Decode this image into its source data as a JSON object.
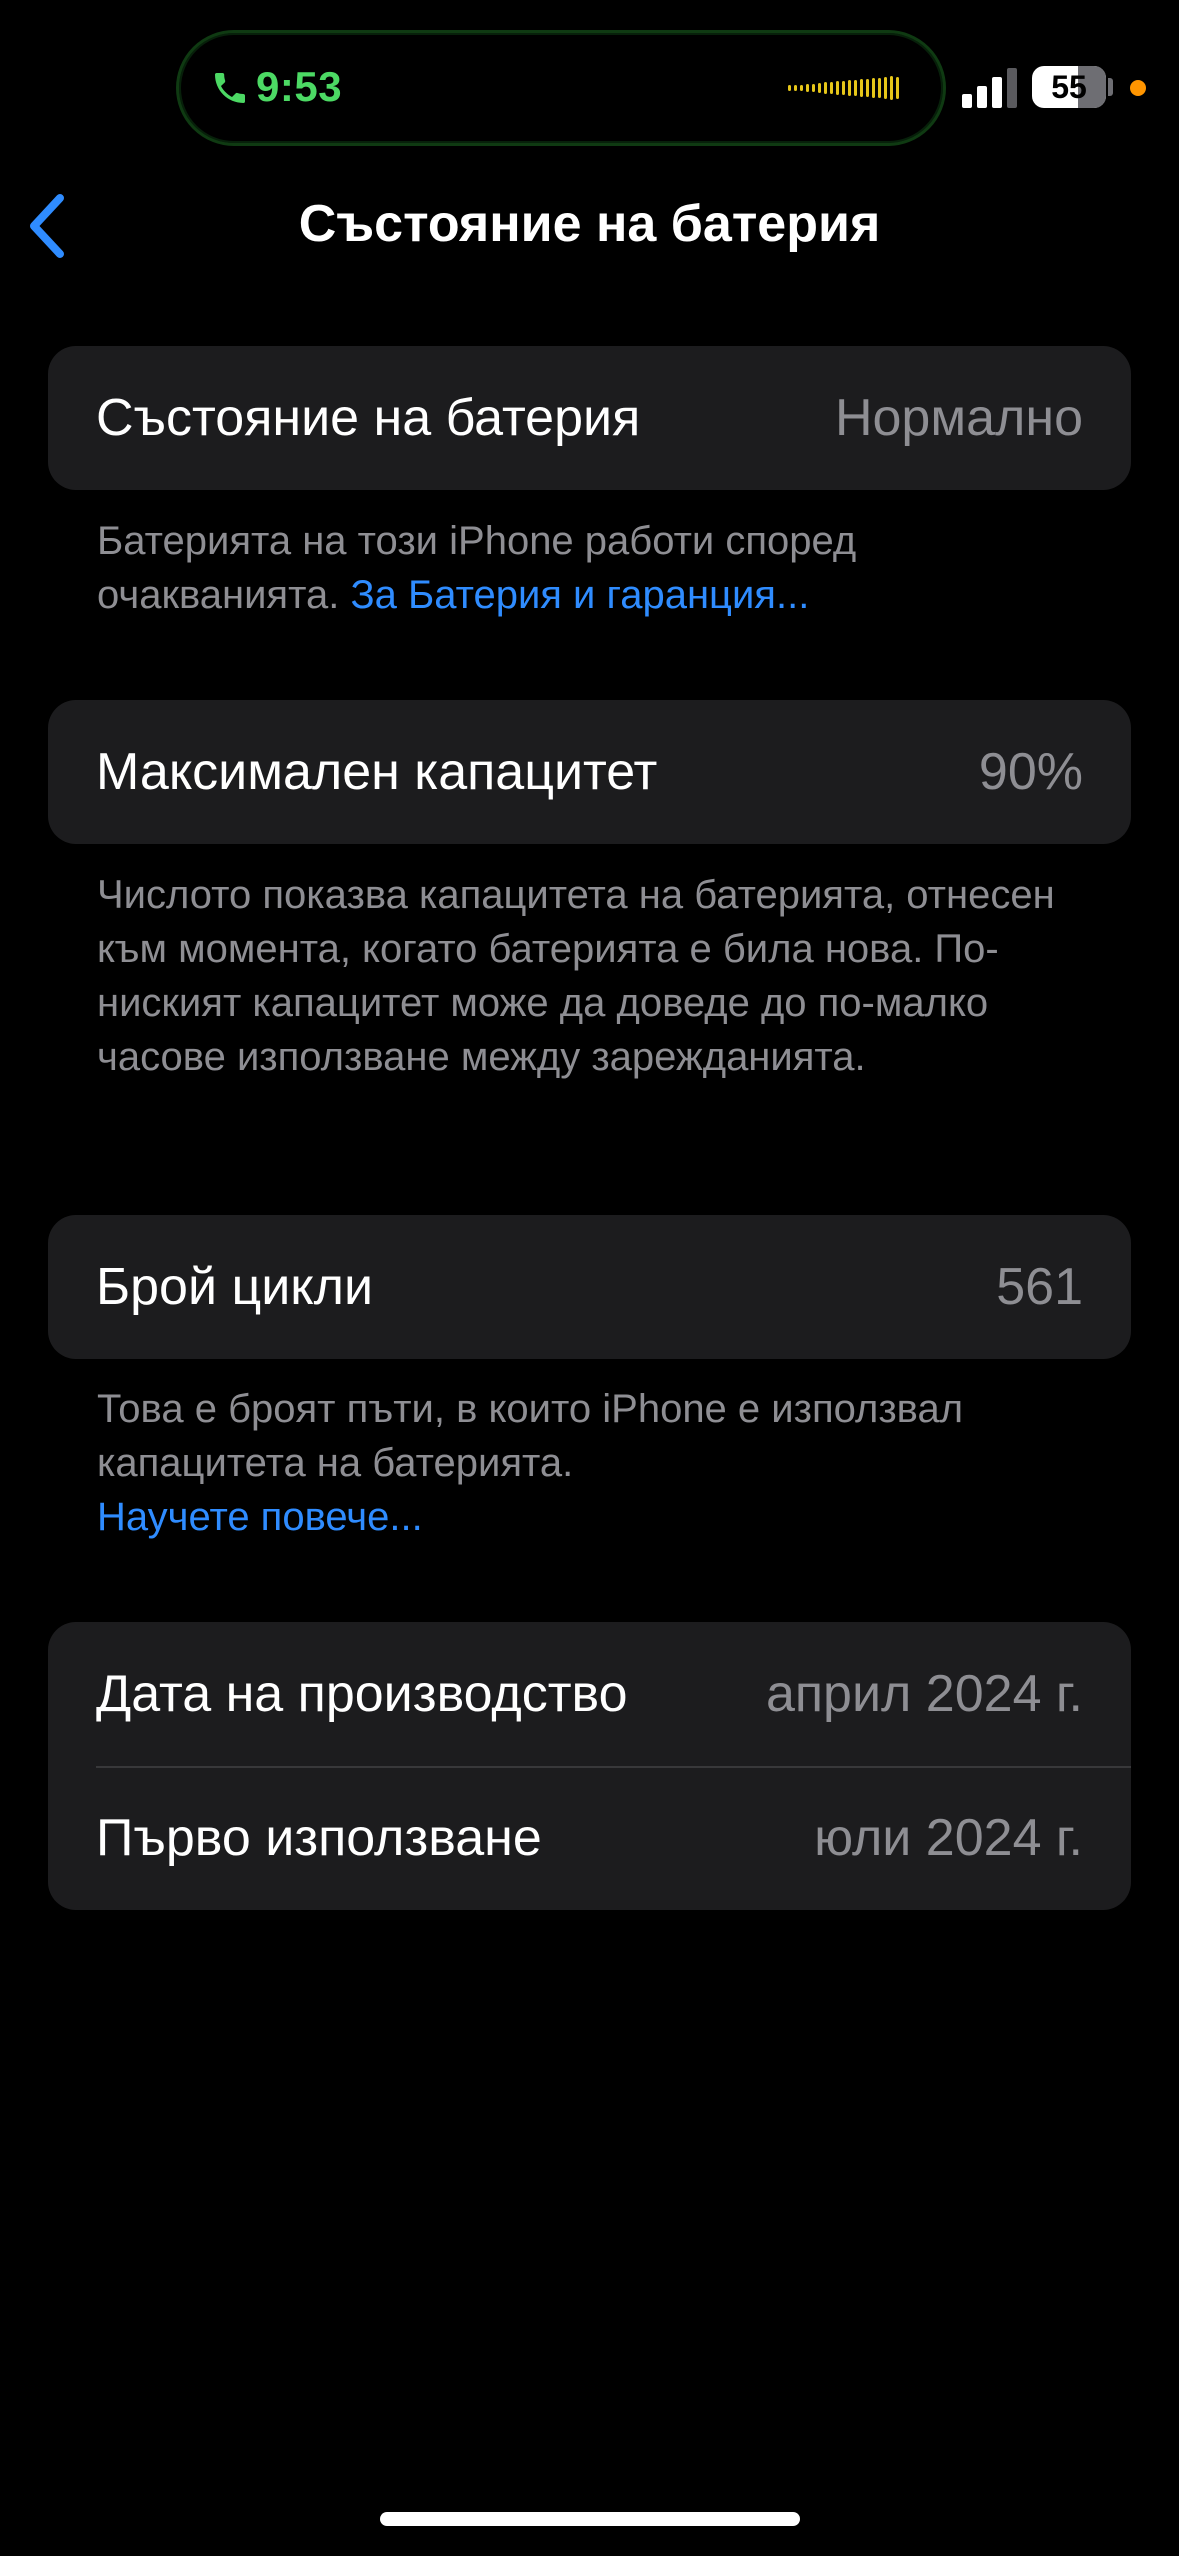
{
  "status_bar": {
    "call_time": "9:53",
    "battery_level": "55",
    "call_color": "#4cd964",
    "privacy_dot_color": "#ff9500",
    "icons": [
      "phone-icon",
      "audio-waveform-icon",
      "cellular-signal-icon",
      "battery-icon"
    ]
  },
  "nav": {
    "title": "Състояние на батерия",
    "back_icon": "chevron-left-icon",
    "accent": "#2f8cff"
  },
  "health": {
    "label": "Състояние на батерия",
    "value": "Нормално",
    "footer_text": "Батерията на този iPhone работи според очакванията. ",
    "footer_link": "За Батерия и гаранция..."
  },
  "capacity": {
    "label": "Максимален капацитет",
    "value": "90%",
    "footer_text": "Числото показва капацитета на батерията, отнесен към момента, когато батерията е била нова. По-ниският капацитет може да доведе до по-малко часове използване между зарежданията."
  },
  "cycles": {
    "label": "Брой цикли",
    "value": "561",
    "footer_text": "Това е броят пъти, в които iPhone е използвал капацитета на батерията.",
    "footer_link": "Научете повече..."
  },
  "dates": {
    "manufacture_label": "Дата на производство",
    "manufacture_value": "април 2024 г.",
    "first_use_label": "Първо използване",
    "first_use_value": "юли 2024 г."
  }
}
